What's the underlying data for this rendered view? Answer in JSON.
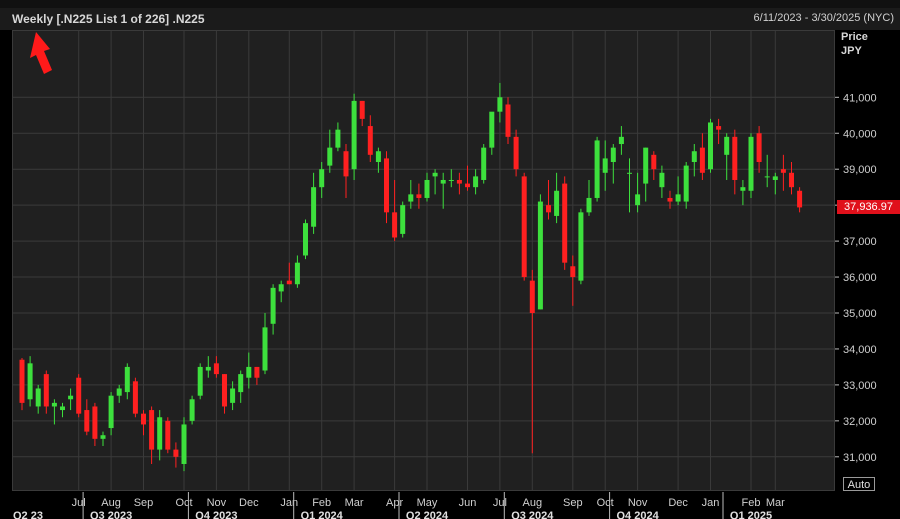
{
  "header": {
    "title": "Weekly [.N225 List 1 of 226] .N225",
    "date_range": "6/11/2023 - 3/30/2025 (NYC)"
  },
  "y_axis": {
    "title_line1": "Price",
    "title_line2": "JPY"
  },
  "auto_button": {
    "label": "Auto"
  },
  "colors": {
    "up": "#3de03d",
    "down": "#ff2020",
    "last_price_tag": "#e0101b",
    "grid": "#3a3a3a"
  },
  "chart_data": {
    "type": "candlestick",
    "title": "Weekly [.N225 List 1 of 226] .N225",
    "ylabel": "Price JPY",
    "ylim": [
      30500,
      42200
    ],
    "yticks": [
      31000,
      32000,
      33000,
      34000,
      35000,
      36000,
      37000,
      38000,
      39000,
      40000,
      41000
    ],
    "ytick_labels": [
      "31,000",
      "32,000",
      "33,000",
      "34,000",
      "35,000",
      "36,000",
      "37,000",
      "38,000",
      "39,000",
      "40,000",
      "41,000"
    ],
    "last_price": 37936.97,
    "last_price_label": "37,936.97",
    "x_months": [
      {
        "label": "Jul",
        "week": 7
      },
      {
        "label": "Aug",
        "week": 11
      },
      {
        "label": "Sep",
        "week": 15
      },
      {
        "label": "Oct",
        "week": 20
      },
      {
        "label": "Nov",
        "week": 24
      },
      {
        "label": "Dec",
        "week": 28
      },
      {
        "label": "Jan",
        "week": 33
      },
      {
        "label": "Feb",
        "week": 37
      },
      {
        "label": "Mar",
        "week": 41
      },
      {
        "label": "Apr",
        "week": 46
      },
      {
        "label": "May",
        "week": 50
      },
      {
        "label": "Jun",
        "week": 55
      },
      {
        "label": "Jul",
        "week": 59
      },
      {
        "label": "Aug",
        "week": 63
      },
      {
        "label": "Sep",
        "week": 68
      },
      {
        "label": "Oct",
        "week": 72
      },
      {
        "label": "Nov",
        "week": 76
      },
      {
        "label": "Dec",
        "week": 81
      },
      {
        "label": "Jan",
        "week": 85
      },
      {
        "label": "Feb",
        "week": 90
      },
      {
        "label": "Mar",
        "week": 93
      }
    ],
    "x_quarters": [
      {
        "label": "Q2 23",
        "week": 1
      },
      {
        "label": "Q3 2023",
        "week": 11
      },
      {
        "label": "Q4 2023",
        "week": 24
      },
      {
        "label": "Q1 2024",
        "week": 37
      },
      {
        "label": "Q2 2024",
        "week": 50
      },
      {
        "label": "Q3 2024",
        "week": 63
      },
      {
        "label": "Q4 2024",
        "week": 76
      },
      {
        "label": "Q1 2025",
        "week": 90
      }
    ],
    "candles": [
      [
        33700,
        33750,
        32300,
        32500
      ],
      [
        32600,
        33800,
        32400,
        33600
      ],
      [
        32400,
        33000,
        32200,
        32900
      ],
      [
        33300,
        33400,
        32200,
        32400
      ],
      [
        32400,
        32600,
        31900,
        32500
      ],
      [
        32300,
        32500,
        32100,
        32400
      ],
      [
        32600,
        32900,
        32300,
        32700
      ],
      [
        33200,
        33300,
        32100,
        32200
      ],
      [
        32300,
        32600,
        31600,
        31700
      ],
      [
        32400,
        32500,
        31300,
        31500
      ],
      [
        31500,
        31700,
        31300,
        31600
      ],
      [
        31800,
        32800,
        31600,
        32700
      ],
      [
        32700,
        33000,
        32500,
        32900
      ],
      [
        32800,
        33600,
        32600,
        33500
      ],
      [
        33100,
        33200,
        32100,
        32200
      ],
      [
        32200,
        32300,
        31600,
        31900
      ],
      [
        32300,
        32400,
        30800,
        31200
      ],
      [
        31200,
        32300,
        30900,
        32100
      ],
      [
        32000,
        32100,
        31100,
        31200
      ],
      [
        31200,
        31400,
        30700,
        31000
      ],
      [
        30800,
        32100,
        30600,
        31900
      ],
      [
        32000,
        32700,
        31900,
        32600
      ],
      [
        32700,
        33600,
        32600,
        33500
      ],
      [
        33400,
        33800,
        33200,
        33500
      ],
      [
        33600,
        33800,
        33200,
        33300
      ],
      [
        33300,
        33300,
        32200,
        32400
      ],
      [
        32500,
        33100,
        32300,
        32900
      ],
      [
        32800,
        33400,
        32500,
        33300
      ],
      [
        33200,
        33900,
        32900,
        33500
      ],
      [
        33500,
        33500,
        33000,
        33200
      ],
      [
        33400,
        35000,
        33300,
        34600
      ],
      [
        34700,
        35800,
        34400,
        35700
      ],
      [
        35600,
        35900,
        35300,
        35800
      ],
      [
        35900,
        36400,
        35800,
        35800
      ],
      [
        35800,
        36600,
        35700,
        36400
      ],
      [
        36600,
        37600,
        36500,
        37500
      ],
      [
        37400,
        38900,
        37200,
        38500
      ],
      [
        38500,
        39200,
        38200,
        39000
      ],
      [
        39100,
        40100,
        38900,
        39600
      ],
      [
        39600,
        40300,
        39500,
        40100
      ],
      [
        39500,
        39700,
        38200,
        38800
      ],
      [
        39000,
        41100,
        38700,
        40900
      ],
      [
        40900,
        40900,
        40200,
        40400
      ],
      [
        40200,
        40500,
        39200,
        39400
      ],
      [
        39200,
        39600,
        38900,
        39500
      ],
      [
        39300,
        39500,
        37500,
        37800
      ],
      [
        37800,
        38700,
        37000,
        37100
      ],
      [
        37200,
        38100,
        37100,
        38000
      ],
      [
        38100,
        38700,
        37900,
        38300
      ],
      [
        38300,
        38600,
        37900,
        38200
      ],
      [
        38200,
        38900,
        38100,
        38700
      ],
      [
        38800,
        39000,
        38300,
        38900
      ],
      [
        38600,
        38900,
        37900,
        38700
      ],
      [
        38700,
        39000,
        38500,
        38700
      ],
      [
        38700,
        38900,
        38300,
        38600
      ],
      [
        38600,
        39100,
        38400,
        38500
      ],
      [
        38500,
        39000,
        38300,
        38800
      ],
      [
        38700,
        39700,
        38600,
        39600
      ],
      [
        39600,
        40500,
        39400,
        40600
      ],
      [
        40600,
        41400,
        40300,
        41000
      ],
      [
        40800,
        41000,
        39700,
        39900
      ],
      [
        39900,
        40100,
        38800,
        39000
      ],
      [
        38800,
        38900,
        35900,
        36000
      ],
      [
        35900,
        36200,
        31100,
        35000
      ],
      [
        35100,
        38300,
        35100,
        38100
      ],
      [
        38000,
        38700,
        37600,
        37800
      ],
      [
        37700,
        38900,
        37500,
        38400
      ],
      [
        38600,
        38800,
        36200,
        36400
      ],
      [
        36300,
        36600,
        35200,
        36000
      ],
      [
        35900,
        37900,
        35800,
        37800
      ],
      [
        37800,
        38700,
        37700,
        38200
      ],
      [
        38200,
        39900,
        38100,
        39800
      ],
      [
        38900,
        39800,
        38400,
        39300
      ],
      [
        39200,
        39700,
        38600,
        39600
      ],
      [
        39700,
        40200,
        39400,
        39900
      ],
      [
        38900,
        39300,
        37800,
        38900
      ],
      [
        38000,
        38900,
        37800,
        38300
      ],
      [
        38600,
        39600,
        38100,
        39600
      ],
      [
        39400,
        39500,
        38700,
        39000
      ],
      [
        38500,
        39100,
        38200,
        38900
      ],
      [
        38200,
        38400,
        37900,
        38100
      ],
      [
        38100,
        38800,
        38000,
        38300
      ],
      [
        38100,
        39200,
        37900,
        39100
      ],
      [
        39200,
        39700,
        38800,
        39500
      ],
      [
        39600,
        40000,
        38700,
        38900
      ],
      [
        39000,
        40400,
        38900,
        40300
      ],
      [
        40200,
        40400,
        39700,
        40100
      ],
      [
        39400,
        40000,
        38700,
        39900
      ],
      [
        39900,
        40100,
        38300,
        38700
      ],
      [
        38400,
        38700,
        38000,
        38500
      ],
      [
        38400,
        40000,
        38200,
        39900
      ],
      [
        40000,
        40200,
        38900,
        39200
      ],
      [
        38800,
        39400,
        38500,
        38800
      ],
      [
        38700,
        38900,
        38300,
        38800
      ],
      [
        39000,
        39400,
        38400,
        38900
      ],
      [
        38900,
        39200,
        38300,
        38500
      ],
      [
        38400,
        38500,
        37800,
        37937
      ]
    ]
  }
}
